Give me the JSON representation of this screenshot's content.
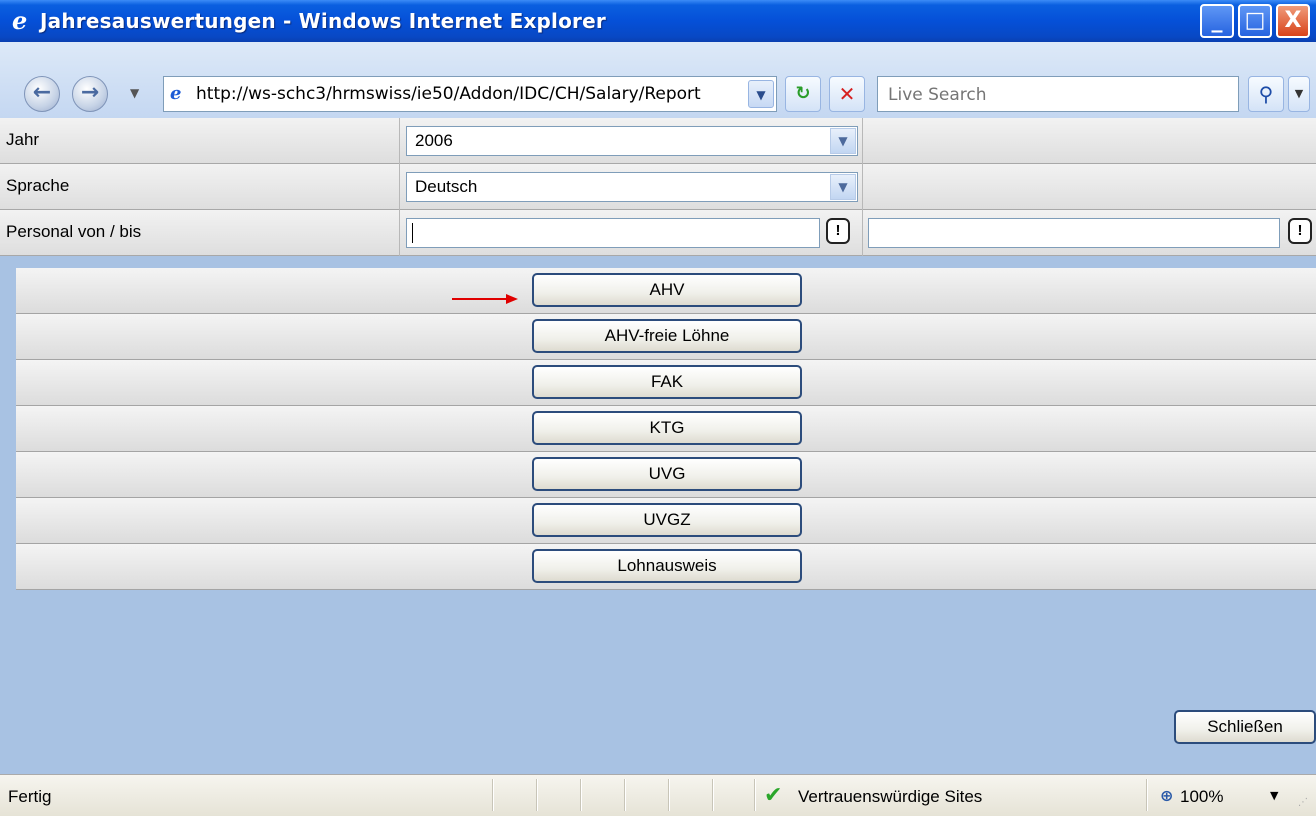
{
  "window": {
    "title": "Jahresauswertungen - Windows Internet Explorer",
    "minimize": "_",
    "maximize": "□",
    "close": "X"
  },
  "nav": {
    "back": "←",
    "forward": "→",
    "dropdown": "▼",
    "address": "http://ws-schc3/hrmswiss/ie50/Addon/IDC/CH/Salary/Report",
    "address_drop": "▼",
    "refresh": "↻",
    "stop": "✕",
    "search_placeholder": "Live Search",
    "search_icon": "⚲",
    "search_drop": "▼"
  },
  "form": {
    "year_label": "Jahr",
    "year_value": "2006",
    "language_label": "Sprache",
    "language_value": "Deutsch",
    "staff_label": "Personal von / bis",
    "staff_from": "",
    "staff_to": "",
    "lookup_glyph": "!",
    "select_drop": "▼"
  },
  "reports": [
    {
      "label": "AHV"
    },
    {
      "label": "AHV-freie Löhne"
    },
    {
      "label": "FAK"
    },
    {
      "label": "KTG"
    },
    {
      "label": "UVG"
    },
    {
      "label": "UVGZ"
    },
    {
      "label": "Lohnausweis"
    }
  ],
  "close_button": "Schließen",
  "status": {
    "text": "Fertig",
    "zone": "Vertrauenswürdige Sites",
    "zone_icon": "✔",
    "zoom": "100%",
    "zoom_icon": "⊕",
    "zoom_drop": "▼"
  },
  "colors": {
    "titlebar": "#0550d8",
    "content_bg": "#a8c2e3",
    "arrow": "#e00000",
    "button_border": "#2c4c7c"
  }
}
